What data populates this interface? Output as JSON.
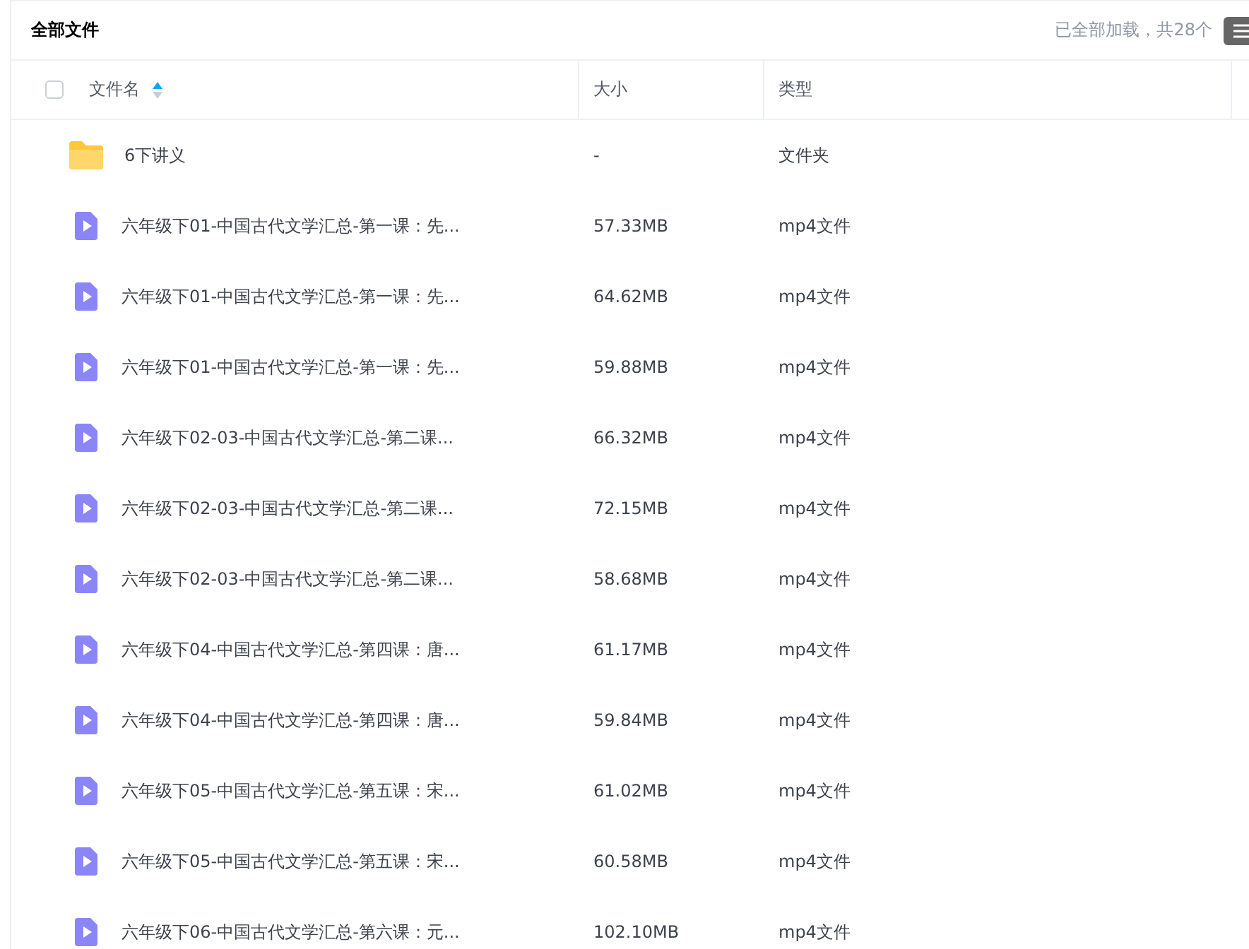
{
  "header": {
    "title": "全部文件",
    "status": "已全部加载，共28个"
  },
  "table": {
    "select_all": {
      "checked": false
    },
    "sort": {
      "ascending": true
    },
    "columns": [
      "文件名",
      "大小",
      "类型"
    ],
    "rows": [
      {
        "kind": "folder",
        "name": "6下讲义",
        "size": "-",
        "type": "文件夹"
      },
      {
        "kind": "video",
        "name": "六年级下01-中国古代文学汇总-第一课：先...",
        "size": "57.33MB",
        "type": "mp4文件"
      },
      {
        "kind": "video",
        "name": "六年级下01-中国古代文学汇总-第一课：先...",
        "size": "64.62MB",
        "type": "mp4文件"
      },
      {
        "kind": "video",
        "name": "六年级下01-中国古代文学汇总-第一课：先...",
        "size": "59.88MB",
        "type": "mp4文件"
      },
      {
        "kind": "video",
        "name": "六年级下02-03-中国古代文学汇总-第二课...",
        "size": "66.32MB",
        "type": "mp4文件"
      },
      {
        "kind": "video",
        "name": "六年级下02-03-中国古代文学汇总-第二课...",
        "size": "72.15MB",
        "type": "mp4文件"
      },
      {
        "kind": "video",
        "name": "六年级下02-03-中国古代文学汇总-第二课...",
        "size": "58.68MB",
        "type": "mp4文件"
      },
      {
        "kind": "video",
        "name": "六年级下04-中国古代文学汇总-第四课：唐...",
        "size": "61.17MB",
        "type": "mp4文件"
      },
      {
        "kind": "video",
        "name": "六年级下04-中国古代文学汇总-第四课：唐...",
        "size": "59.84MB",
        "type": "mp4文件"
      },
      {
        "kind": "video",
        "name": "六年级下05-中国古代文学汇总-第五课：宋...",
        "size": "61.02MB",
        "type": "mp4文件"
      },
      {
        "kind": "video",
        "name": "六年级下05-中国古代文学汇总-第五课：宋...",
        "size": "60.58MB",
        "type": "mp4文件"
      },
      {
        "kind": "video",
        "name": "六年级下06-中国古代文学汇总-第六课：元...",
        "size": "102.10MB",
        "type": "mp4文件"
      }
    ]
  }
}
